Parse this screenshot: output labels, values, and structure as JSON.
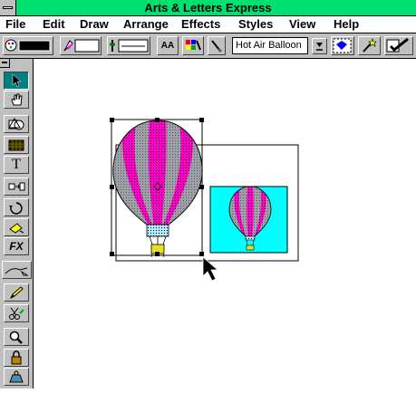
{
  "window": {
    "title": "Arts & Letters Express"
  },
  "menu": [
    "File",
    "Edit",
    "Draw",
    "Arrange",
    "Effects",
    "Styles",
    "View",
    "Help"
  ],
  "toolbar": {
    "style_name": "Hot Air Balloon",
    "text_tool_label": "AA"
  },
  "tools": {
    "text_label": "T",
    "fx_label": "FX"
  },
  "colors": {
    "title_bar": "#00e070",
    "chrome": "#c0c0c0",
    "balloon_pink": "#ff00c8",
    "balloon_gray": "#9ea0a8",
    "preview_bg": "#00ffff",
    "active_tool": "#008080"
  },
  "icons": {
    "system_menu": "system-menu-icon",
    "pointer": "arrow-pointer-icon",
    "hand": "hand-icon",
    "shapes": "shapes-icon",
    "grid": "grid-icon",
    "text": "text-tool-icon",
    "node": "node-edit-icon",
    "rotate": "rotate-icon",
    "fill": "fill-icon",
    "fx": "fx-icon",
    "line": "line-tool-icon",
    "pencil": "pencil-icon",
    "scissors": "scissors-icon",
    "zoom": "zoom-icon",
    "lock": "lock-icon",
    "weight": "weight-icon"
  }
}
